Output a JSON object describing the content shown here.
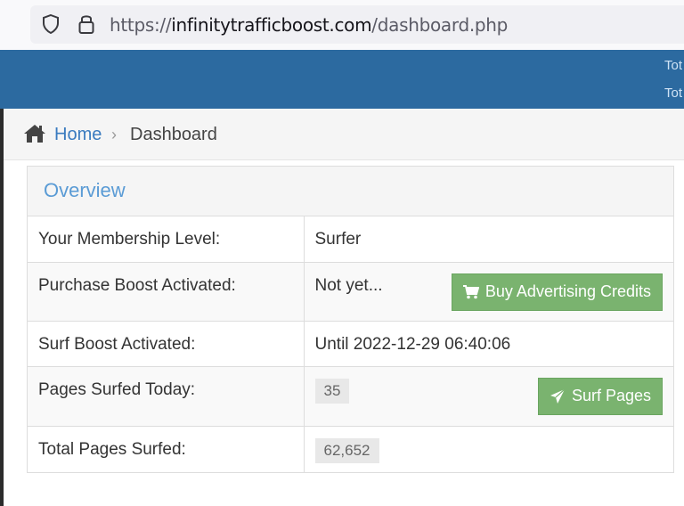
{
  "browser": {
    "url_prefix": "https://",
    "url_domain": "infinitytrafficboost.com",
    "url_path": "/dashboard.php"
  },
  "header": {
    "line1": "Tot",
    "line2": "Tot"
  },
  "breadcrumb": {
    "home": "Home",
    "separator": "›",
    "current": "Dashboard"
  },
  "panel": {
    "title": "Overview",
    "rows": [
      {
        "label": "Your Membership Level:",
        "value": "Surfer"
      },
      {
        "label": "Purchase Boost Activated:",
        "value": "Not yet...",
        "button": "Buy Advertising Credits"
      },
      {
        "label": "Surf Boost Activated:",
        "value": "Until 2022-12-29 06:40:06"
      },
      {
        "label": "Pages Surfed Today:",
        "value": "35",
        "button": "Surf Pages"
      },
      {
        "label": "Total Pages Surfed:",
        "value": "62,652"
      }
    ]
  },
  "colors": {
    "header_blue": "#2c6aa0",
    "link_blue": "#3a7bbf",
    "button_green": "#7ab36f"
  },
  "icons": [
    "shield-icon",
    "lock-icon",
    "home-icon",
    "cart-icon",
    "paper-plane-icon"
  ]
}
